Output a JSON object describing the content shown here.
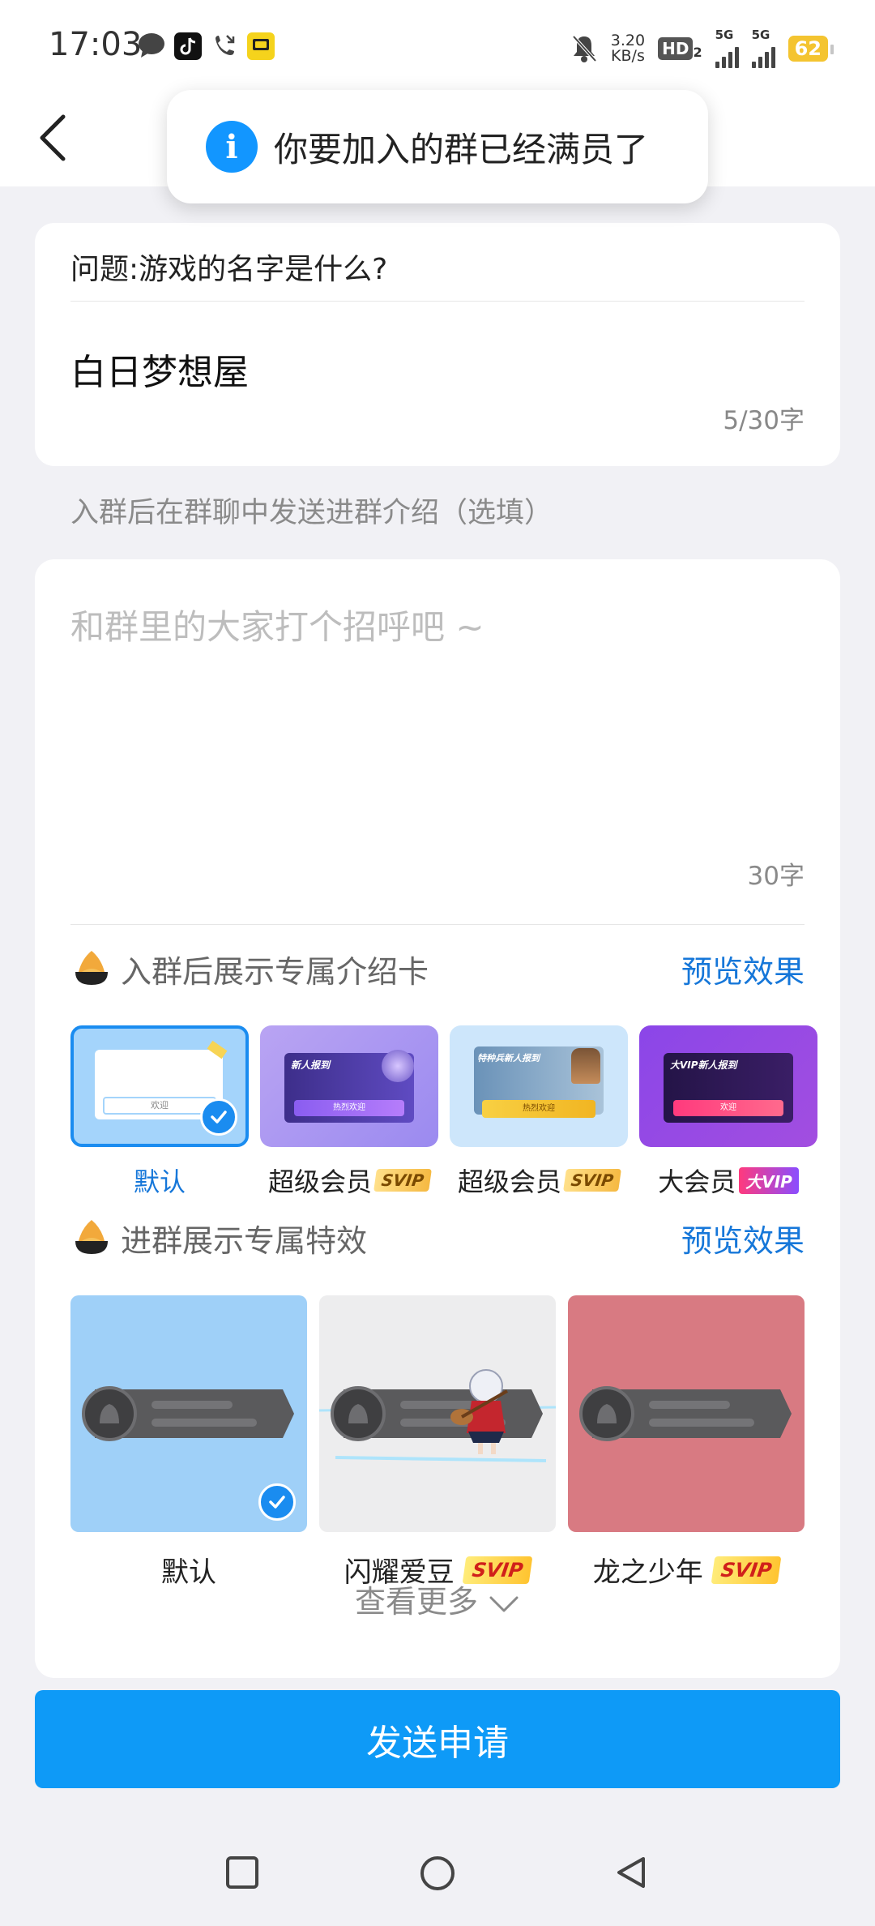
{
  "status_bar": {
    "time": "17:03",
    "speed_value": "3.20",
    "speed_unit": "KB/s",
    "hd": "HD",
    "hd_sub": "2",
    "sig1": "5G",
    "sig2": "5G",
    "battery": "62"
  },
  "toast": {
    "icon": "i",
    "text": "你要加入的群已经满员了"
  },
  "question": {
    "title": "问题:游戏的名字是什么?",
    "answer": "白日梦想屋",
    "counter": "5/30字"
  },
  "intro": {
    "section_label": "入群后在群聊中发送进群介绍（选填）",
    "placeholder": "和群里的大家打个招呼吧 ~",
    "counter": "30字"
  },
  "intro_cards": {
    "title": "入群后展示专属介绍卡",
    "preview_link": "预览效果",
    "items": [
      {
        "label": "默认",
        "badge": "",
        "thumb_text": "欢迎",
        "selected": true
      },
      {
        "label": "超级会员",
        "badge": "SVIP",
        "thumb_text": "新人报到",
        "btn_text": "热烈欢迎",
        "selected": false
      },
      {
        "label": "超级会员",
        "badge": "SVIP",
        "thumb_text": "特种兵新人报到",
        "btn_text": "热烈欢迎",
        "selected": false
      },
      {
        "label": "大会员",
        "badge": "大VIP",
        "thumb_text": "大VIP新人报到",
        "btn_text": "欢迎",
        "selected": false
      }
    ]
  },
  "effects": {
    "title": "进群展示专属特效",
    "preview_link": "预览效果",
    "items": [
      {
        "label": "默认",
        "badge": "",
        "selected": true
      },
      {
        "label": "闪耀爱豆",
        "badge": "SVIP",
        "selected": false
      },
      {
        "label": "龙之少年",
        "badge": "SVIP",
        "selected": false
      }
    ],
    "more": "查看更多"
  },
  "submit_label": "发送申请",
  "colors": {
    "accent": "#0e9af7",
    "link": "#1677d9",
    "selected_card": "#a4d4fb"
  }
}
